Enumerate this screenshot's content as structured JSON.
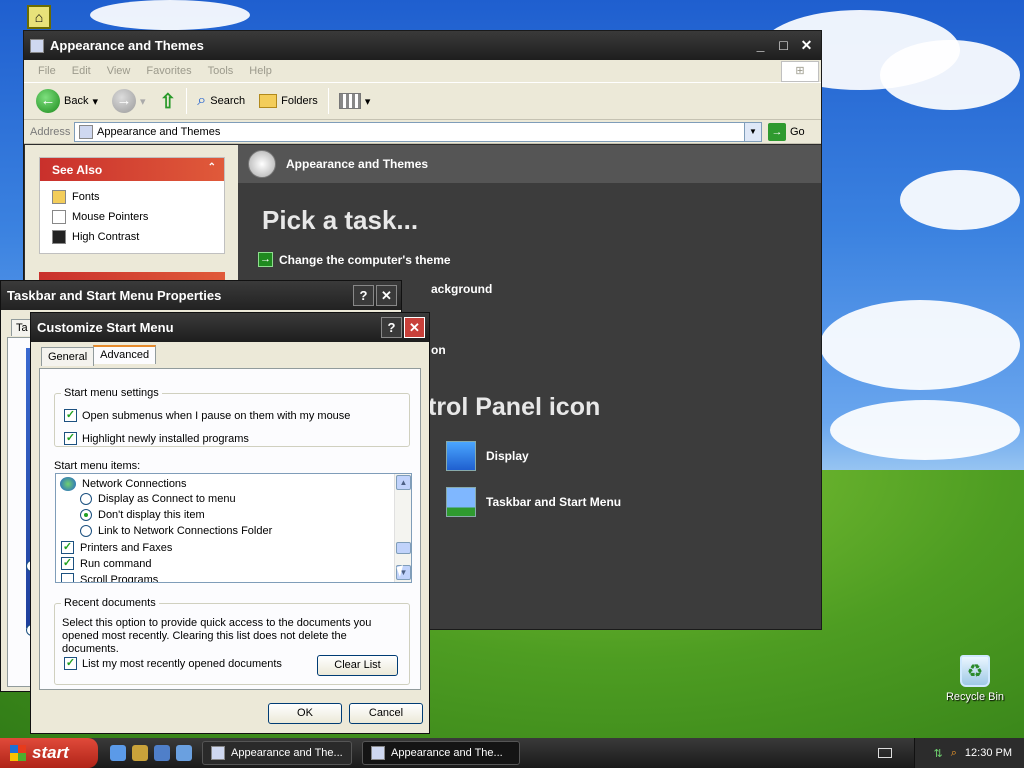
{
  "desktop": {
    "recycle_bin_label": "Recycle Bin"
  },
  "main_window": {
    "title": "Appearance and Themes",
    "menu": [
      "File",
      "Edit",
      "View",
      "Favorites",
      "Tools",
      "Help"
    ],
    "toolbar": {
      "back": "Back",
      "search": "Search",
      "folders": "Folders"
    },
    "address": {
      "label": "Address",
      "value": "Appearance and Themes",
      "go": "Go"
    },
    "see_also": {
      "title": "See Also",
      "items": [
        "Fonts",
        "Mouse Pointers",
        "High Contrast"
      ]
    },
    "content": {
      "header": "Appearance and Themes",
      "pick_task": "Pick a task...",
      "tasks": [
        "Change the computer's theme",
        "ackground",
        "on"
      ],
      "pick_icon": "trol Panel icon",
      "icons": [
        "Display",
        "Taskbar and Start Menu"
      ]
    }
  },
  "taskbar_props": {
    "title": "Taskbar and Start Menu Properties",
    "tab_stub": "Ta"
  },
  "customize": {
    "title": "Customize Start Menu",
    "tabs": [
      "General",
      "Advanced"
    ],
    "settings_group": "Start menu settings",
    "settings": [
      {
        "label": "Open submenus when I pause on them with my mouse",
        "checked": true
      },
      {
        "label": "Highlight newly installed programs",
        "checked": true
      }
    ],
    "items_label": "Start menu items:",
    "items": {
      "network": "Network Connections",
      "radio": [
        {
          "label": "Display as Connect to menu",
          "selected": false
        },
        {
          "label": "Don't display this item",
          "selected": true
        },
        {
          "label": "Link to Network Connections Folder",
          "selected": false
        }
      ],
      "printers": "Printers and Faxes",
      "run": "Run command",
      "scroll": "Scroll Programs"
    },
    "recent_group": "Recent documents",
    "recent_desc_1": "Select this option to provide quick access to the documents you",
    "recent_desc_2": "opened most recently.  Clearing this list does not delete the documents.",
    "recent_check": "List my most recently opened documents",
    "clear_list": "Clear List",
    "ok": "OK",
    "cancel": "Cancel"
  },
  "taskbar": {
    "start": "start",
    "tasks": [
      "Appearance and The...",
      "Appearance and The..."
    ],
    "clock": "12:30 PM"
  }
}
